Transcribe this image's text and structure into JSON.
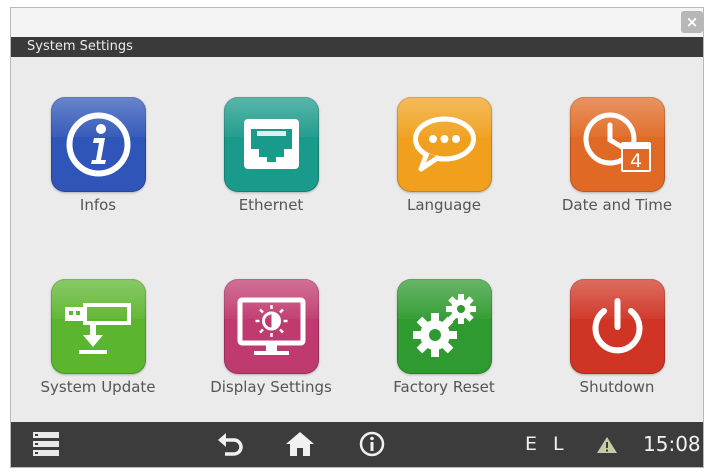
{
  "window": {
    "title": "System Settings",
    "close_glyph": "×"
  },
  "tiles": [
    {
      "label": "Infos",
      "icon": "info-icon",
      "color": "#2f55b8"
    },
    {
      "label": "Ethernet",
      "icon": "ethernet-port-icon",
      "color": "#1a9a8a"
    },
    {
      "label": "Language",
      "icon": "speech-bubble-icon",
      "color": "#f0a01c"
    },
    {
      "label": "Date and Time",
      "icon": "clock-calendar-icon",
      "color": "#e06a25",
      "calendar_day": "4"
    },
    {
      "label": "System Update",
      "icon": "usb-download-icon",
      "color": "#5cb52e"
    },
    {
      "label": "Display Settings",
      "icon": "monitor-brightness-icon",
      "color": "#bf3a6e"
    },
    {
      "label": "Factory Reset",
      "icon": "gears-icon",
      "color": "#2f9a2f"
    },
    {
      "label": "Shutdown",
      "icon": "power-icon",
      "color": "#cf3424"
    }
  ],
  "statusbar": {
    "menu_icon": "menu-list-icon",
    "back_icon": "back-arrow-icon",
    "home_icon": "home-icon",
    "info_icon": "info-circle-icon",
    "indicator_e": "E",
    "indicator_l": "L",
    "warning_icon": "warning-triangle-icon",
    "time": "15:08"
  }
}
